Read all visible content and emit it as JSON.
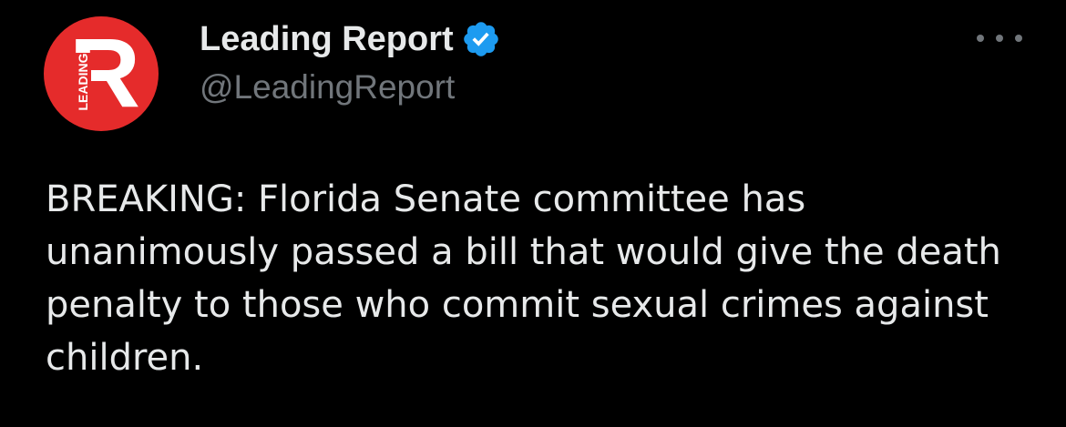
{
  "author": {
    "display_name": "Leading Report",
    "handle": "@LeadingReport",
    "verified": true,
    "verified_color": "#1d9bf0",
    "avatar": {
      "background": "#e52b2b",
      "letter": "R",
      "word": "LEADING"
    }
  },
  "more_menu": {
    "icon": "more-horizontal-icon"
  },
  "tweet": {
    "text": "BREAKING: Florida Senate committee has unanimously passed a bill that would give the death penalty to those who commit sexual crimes against children."
  },
  "theme": {
    "background": "#000000",
    "text": "#e7e9ea",
    "secondary_text": "#71767b"
  }
}
